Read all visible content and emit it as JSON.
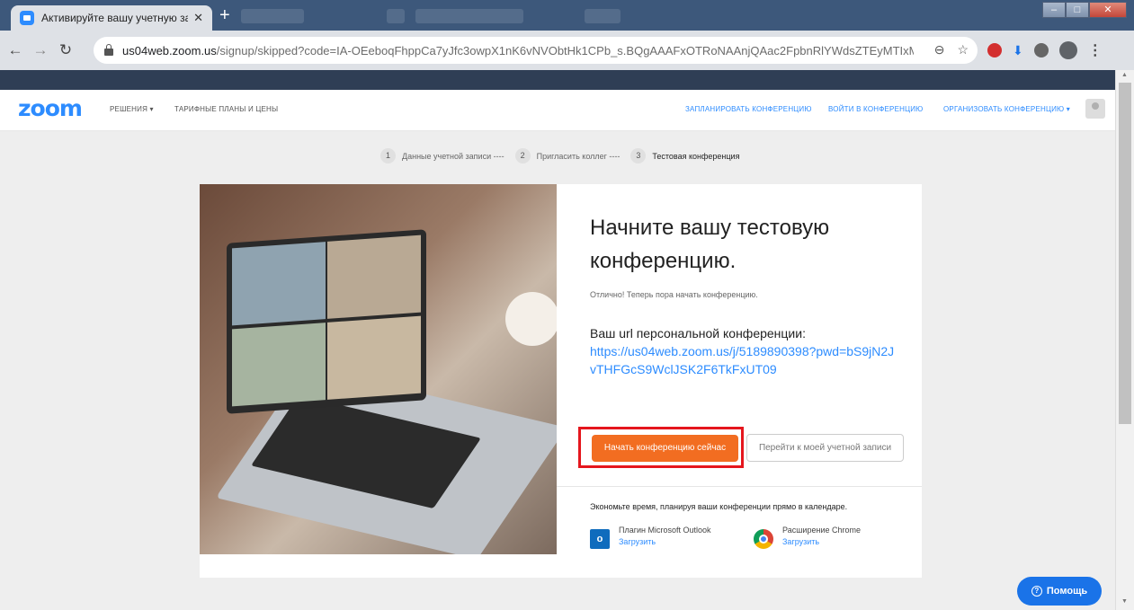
{
  "browser": {
    "tab_title": "Активируйте вашу учетную запи",
    "tab_close": "✕",
    "new_tab": "+",
    "url_host": "us04web.zoom.us",
    "url_path": "/signup/skipped?code=IA-OEeboqFhppCa7yJfc3owpX1nK6vNVObtHk1CPb_s.BQgAAAFxOTRoNAAnjQAac2FpbnRlYWdsZTEyMTIxMjEyQ...",
    "icons": [
      "back-icon",
      "forward-icon",
      "reload-icon",
      "lock-icon",
      "zoom-magnifier-icon",
      "bookmark-star-icon",
      "adblock-icon",
      "download-icon",
      "extension-globe-icon",
      "profile-icon",
      "menu-icon"
    ]
  },
  "zoom_nav": {
    "logo": "zoom",
    "solutions": "РЕШЕНИЯ ▾",
    "plans": "ТАРИФНЫЕ ПЛАНЫ И ЦЕНЫ",
    "schedule": "ЗАПЛАНИРОВАТЬ КОНФЕРЕНЦИЮ",
    "join": "ВОЙТИ В КОНФЕРЕНЦИЮ",
    "host": "ОРГАНИЗОВАТЬ КОНФЕРЕНЦИЮ ▾"
  },
  "steps": [
    {
      "num": "1",
      "label": "Данные учетной записи ----"
    },
    {
      "num": "2",
      "label": "Пригласить коллег ----"
    },
    {
      "num": "3",
      "label": "Тестовая конференция"
    }
  ],
  "main": {
    "title": "Начните вашу тестовую конференцию.",
    "subtitle": "Отлично! Теперь пора начать конференцию.",
    "pmi_label": "Ваш url персональной конференции:",
    "pmi_link": "https://us04web.zoom.us/j/5189890398?pwd=bS9jN2JvTHFGcS9WclJSK2F6TkFxUT09",
    "start_button": "Начать конференцию сейчас",
    "account_button": "Перейти к моей учетной записи",
    "save_time": "Экономьте время, планируя ваши конференции прямо в календаре.",
    "outlook_name": "Плагин Microsoft Outlook",
    "outlook_download": "Загрузить",
    "outlook_icon_text": "o",
    "chrome_name": "Расширение Chrome",
    "chrome_download": "Загрузить"
  },
  "help": {
    "label": "Помощь",
    "icon": "?"
  },
  "colors": {
    "zoom_blue": "#2d8cff",
    "start_orange": "#f26d21",
    "highlight_red": "#e5161d"
  }
}
